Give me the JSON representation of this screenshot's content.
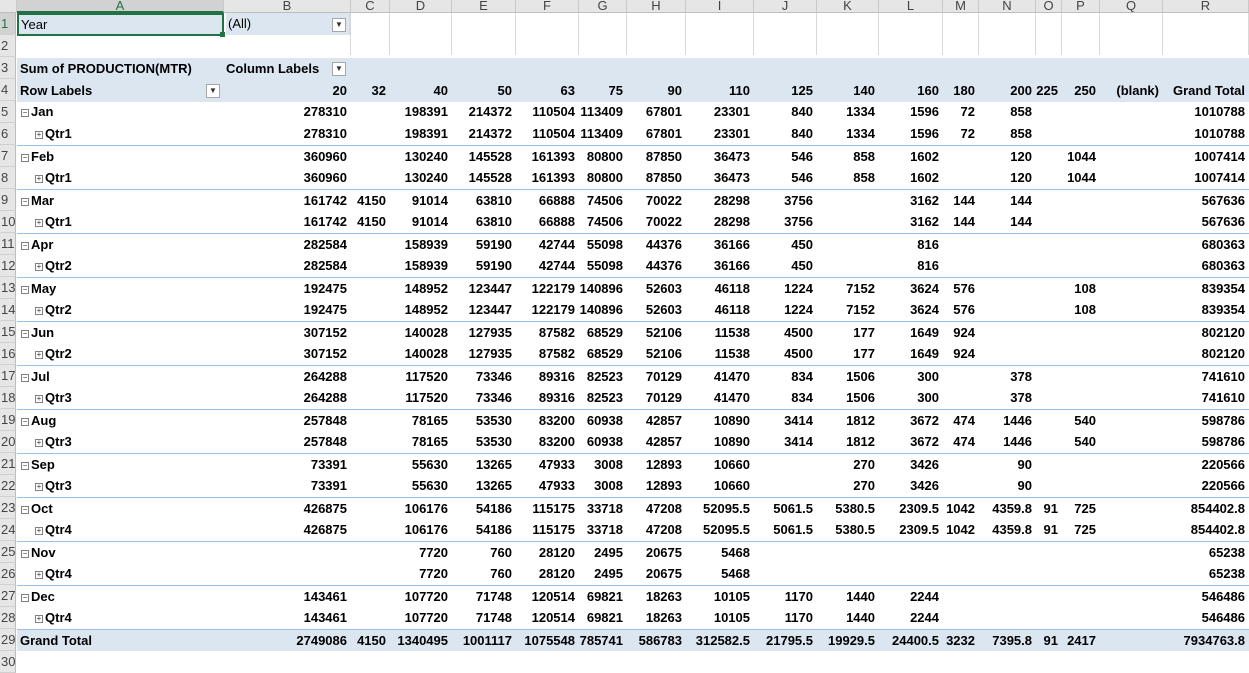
{
  "column_headers": [
    "A",
    "B",
    "C",
    "D",
    "E",
    "F",
    "G",
    "H",
    "I",
    "J",
    "K",
    "L",
    "M",
    "N",
    "O",
    "P",
    "Q",
    "R"
  ],
  "row_numbers": [
    "1",
    "2",
    "3",
    "4",
    "5",
    "6",
    "7",
    "8",
    "9",
    "10",
    "11",
    "12",
    "13",
    "14",
    "15",
    "16",
    "17",
    "18",
    "19",
    "20",
    "21",
    "22",
    "23",
    "24",
    "25",
    "26",
    "27",
    "28",
    "29",
    "30"
  ],
  "filter": {
    "label": "Year",
    "value": "(All)"
  },
  "pivot": {
    "value_field": "Sum of PRODUCTION(MTR)",
    "column_labels": "Column Labels",
    "row_labels": "Row Labels",
    "columns": [
      "20",
      "32",
      "40",
      "50",
      "63",
      "75",
      "90",
      "110",
      "125",
      "140",
      "160",
      "180",
      "200",
      "225",
      "250",
      "(blank)",
      "Grand Total"
    ],
    "rows": [
      {
        "label": "Jan",
        "level": 0,
        "values": [
          "278310",
          "",
          "198391",
          "214372",
          "110504",
          "113409",
          "67801",
          "23301",
          "840",
          "1334",
          "1596",
          "72",
          "858",
          "",
          "",
          "",
          "1010788"
        ]
      },
      {
        "label": "Qtr1",
        "level": 1,
        "values": [
          "278310",
          "",
          "198391",
          "214372",
          "110504",
          "113409",
          "67801",
          "23301",
          "840",
          "1334",
          "1596",
          "72",
          "858",
          "",
          "",
          "",
          "1010788"
        ]
      },
      {
        "label": "Feb",
        "level": 0,
        "values": [
          "360960",
          "",
          "130240",
          "145528",
          "161393",
          "80800",
          "87850",
          "36473",
          "546",
          "858",
          "1602",
          "",
          "120",
          "",
          "1044",
          "",
          "1007414"
        ]
      },
      {
        "label": "Qtr1",
        "level": 1,
        "values": [
          "360960",
          "",
          "130240",
          "145528",
          "161393",
          "80800",
          "87850",
          "36473",
          "546",
          "858",
          "1602",
          "",
          "120",
          "",
          "1044",
          "",
          "1007414"
        ]
      },
      {
        "label": "Mar",
        "level": 0,
        "values": [
          "161742",
          "4150",
          "91014",
          "63810",
          "66888",
          "74506",
          "70022",
          "28298",
          "3756",
          "",
          "3162",
          "144",
          "144",
          "",
          "",
          "",
          "567636"
        ]
      },
      {
        "label": "Qtr1",
        "level": 1,
        "values": [
          "161742",
          "4150",
          "91014",
          "63810",
          "66888",
          "74506",
          "70022",
          "28298",
          "3756",
          "",
          "3162",
          "144",
          "144",
          "",
          "",
          "",
          "567636"
        ]
      },
      {
        "label": "Apr",
        "level": 0,
        "values": [
          "282584",
          "",
          "158939",
          "59190",
          "42744",
          "55098",
          "44376",
          "36166",
          "450",
          "",
          "816",
          "",
          "",
          "",
          "",
          "",
          "680363"
        ]
      },
      {
        "label": "Qtr2",
        "level": 1,
        "values": [
          "282584",
          "",
          "158939",
          "59190",
          "42744",
          "55098",
          "44376",
          "36166",
          "450",
          "",
          "816",
          "",
          "",
          "",
          "",
          "",
          "680363"
        ]
      },
      {
        "label": "May",
        "level": 0,
        "values": [
          "192475",
          "",
          "148952",
          "123447",
          "122179",
          "140896",
          "52603",
          "46118",
          "1224",
          "7152",
          "3624",
          "576",
          "",
          "",
          "108",
          "",
          "839354"
        ]
      },
      {
        "label": "Qtr2",
        "level": 1,
        "values": [
          "192475",
          "",
          "148952",
          "123447",
          "122179",
          "140896",
          "52603",
          "46118",
          "1224",
          "7152",
          "3624",
          "576",
          "",
          "",
          "108",
          "",
          "839354"
        ]
      },
      {
        "label": "Jun",
        "level": 0,
        "values": [
          "307152",
          "",
          "140028",
          "127935",
          "87582",
          "68529",
          "52106",
          "11538",
          "4500",
          "177",
          "1649",
          "924",
          "",
          "",
          "",
          "",
          "802120"
        ]
      },
      {
        "label": "Qtr2",
        "level": 1,
        "values": [
          "307152",
          "",
          "140028",
          "127935",
          "87582",
          "68529",
          "52106",
          "11538",
          "4500",
          "177",
          "1649",
          "924",
          "",
          "",
          "",
          "",
          "802120"
        ]
      },
      {
        "label": "Jul",
        "level": 0,
        "values": [
          "264288",
          "",
          "117520",
          "73346",
          "89316",
          "82523",
          "70129",
          "41470",
          "834",
          "1506",
          "300",
          "",
          "378",
          "",
          "",
          "",
          "741610"
        ]
      },
      {
        "label": "Qtr3",
        "level": 1,
        "values": [
          "264288",
          "",
          "117520",
          "73346",
          "89316",
          "82523",
          "70129",
          "41470",
          "834",
          "1506",
          "300",
          "",
          "378",
          "",
          "",
          "",
          "741610"
        ]
      },
      {
        "label": "Aug",
        "level": 0,
        "values": [
          "257848",
          "",
          "78165",
          "53530",
          "83200",
          "60938",
          "42857",
          "10890",
          "3414",
          "1812",
          "3672",
          "474",
          "1446",
          "",
          "540",
          "",
          "598786"
        ]
      },
      {
        "label": "Qtr3",
        "level": 1,
        "values": [
          "257848",
          "",
          "78165",
          "53530",
          "83200",
          "60938",
          "42857",
          "10890",
          "3414",
          "1812",
          "3672",
          "474",
          "1446",
          "",
          "540",
          "",
          "598786"
        ]
      },
      {
        "label": "Sep",
        "level": 0,
        "values": [
          "73391",
          "",
          "55630",
          "13265",
          "47933",
          "3008",
          "12893",
          "10660",
          "",
          "270",
          "3426",
          "",
          "90",
          "",
          "",
          "",
          "220566"
        ]
      },
      {
        "label": "Qtr3",
        "level": 1,
        "values": [
          "73391",
          "",
          "55630",
          "13265",
          "47933",
          "3008",
          "12893",
          "10660",
          "",
          "270",
          "3426",
          "",
          "90",
          "",
          "",
          "",
          "220566"
        ]
      },
      {
        "label": "Oct",
        "level": 0,
        "values": [
          "426875",
          "",
          "106176",
          "54186",
          "115175",
          "33718",
          "47208",
          "52095.5",
          "5061.5",
          "5380.5",
          "2309.5",
          "1042",
          "4359.8",
          "91",
          "725",
          "",
          "854402.8"
        ]
      },
      {
        "label": "Qtr4",
        "level": 1,
        "values": [
          "426875",
          "",
          "106176",
          "54186",
          "115175",
          "33718",
          "47208",
          "52095.5",
          "5061.5",
          "5380.5",
          "2309.5",
          "1042",
          "4359.8",
          "91",
          "725",
          "",
          "854402.8"
        ]
      },
      {
        "label": "Nov",
        "level": 0,
        "values": [
          "",
          "",
          "7720",
          "760",
          "28120",
          "2495",
          "20675",
          "5468",
          "",
          "",
          "",
          "",
          "",
          "",
          "",
          "",
          "65238"
        ]
      },
      {
        "label": "Qtr4",
        "level": 1,
        "values": [
          "",
          "",
          "7720",
          "760",
          "28120",
          "2495",
          "20675",
          "5468",
          "",
          "",
          "",
          "",
          "",
          "",
          "",
          "",
          "65238"
        ]
      },
      {
        "label": "Dec",
        "level": 0,
        "values": [
          "143461",
          "",
          "107720",
          "71748",
          "120514",
          "69821",
          "18263",
          "10105",
          "1170",
          "1440",
          "2244",
          "",
          "",
          "",
          "",
          "",
          "546486"
        ]
      },
      {
        "label": "Qtr4",
        "level": 1,
        "values": [
          "143461",
          "",
          "107720",
          "71748",
          "120514",
          "69821",
          "18263",
          "10105",
          "1170",
          "1440",
          "2244",
          "",
          "",
          "",
          "",
          "",
          "546486"
        ]
      }
    ],
    "grand_total": {
      "label": "Grand Total",
      "values": [
        "2749086",
        "4150",
        "1340495",
        "1001117",
        "1075548",
        "785741",
        "586783",
        "312582.5",
        "21795.5",
        "19929.5",
        "24400.5",
        "3232",
        "7395.8",
        "91",
        "2417",
        "",
        "7934763.8"
      ]
    }
  }
}
